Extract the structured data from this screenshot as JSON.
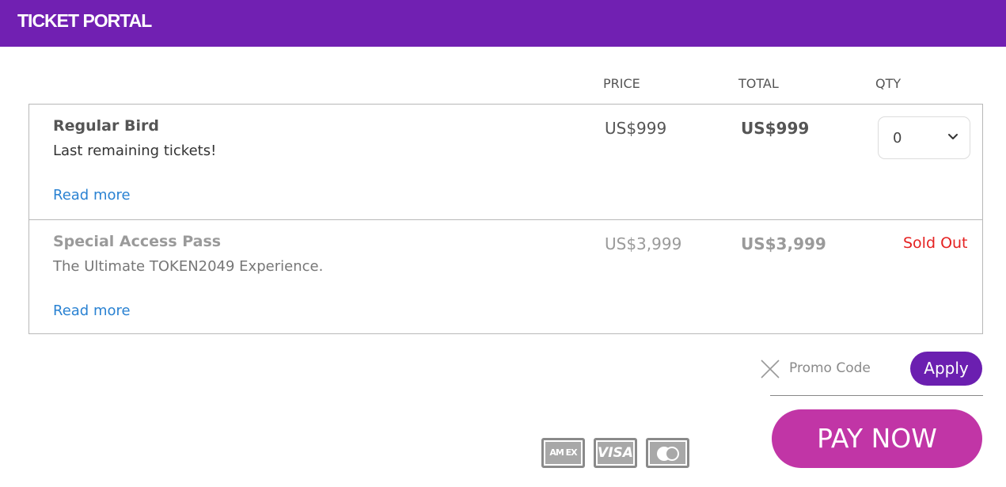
{
  "header": {
    "brand": "TICKET PORTAL"
  },
  "columns": {
    "price": "PRICE",
    "total": "TOTAL",
    "qty": "QTY"
  },
  "tickets": [
    {
      "name": "Regular Bird",
      "description": "Last remaining tickets!",
      "read_more": "Read more",
      "price": "US$999",
      "total": "US$999",
      "qty": "0",
      "sold_out": false
    },
    {
      "name": "Special Access Pass",
      "description": "The Ultimate TOKEN2049 Experience.",
      "read_more": "Read more",
      "price": "US$3,999",
      "total": "US$3,999",
      "status": "Sold Out",
      "sold_out": true
    }
  ],
  "promo": {
    "placeholder": "Promo Code",
    "apply_label": "Apply"
  },
  "payment": {
    "pay_label": "PAY NOW",
    "cards": [
      {
        "name": "amex-card-icon",
        "label": "AM EX"
      },
      {
        "name": "visa-card-icon",
        "label": "VISA"
      },
      {
        "name": "mastercard-card-icon"
      }
    ]
  },
  "colors": {
    "header_bg": "#7120b2",
    "apply_bg": "#6b1fb0",
    "pay_bg": "#c135a6",
    "link": "#2a82d2",
    "sold_out": "#e52222"
  }
}
